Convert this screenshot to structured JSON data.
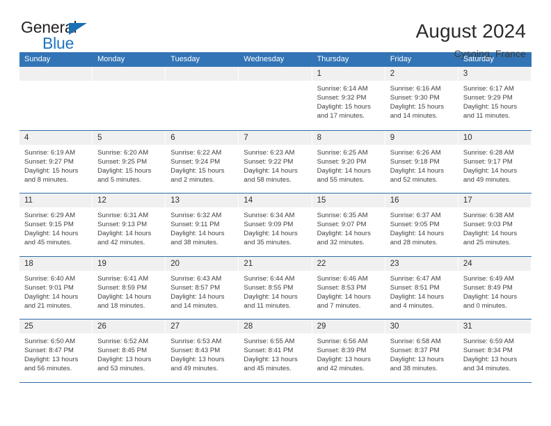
{
  "brand": {
    "name_top": "General",
    "name_bottom": "Blue",
    "triangle_color": "#1a6fb5"
  },
  "header": {
    "title": "August 2024",
    "subtitle": "Cysoing, France"
  },
  "theme": {
    "header_blue": "#3274b5",
    "rule_blue": "#2f6ca8",
    "datebar_gray": "#f0f0f0"
  },
  "calendar": {
    "weekday_headers": [
      "Sunday",
      "Monday",
      "Tuesday",
      "Wednesday",
      "Thursday",
      "Friday",
      "Saturday"
    ],
    "labels": {
      "sunrise": "Sunrise:",
      "sunset": "Sunset:",
      "daylight": "Daylight:"
    },
    "weeks": [
      [
        {
          "day": "",
          "empty": true
        },
        {
          "day": "",
          "empty": true
        },
        {
          "day": "",
          "empty": true
        },
        {
          "day": "",
          "empty": true
        },
        {
          "day": "1",
          "sunrise": "Sunrise: 6:14 AM",
          "sunset": "Sunset: 9:32 PM",
          "daylight1": "Daylight: 15 hours",
          "daylight2": "and 17 minutes."
        },
        {
          "day": "2",
          "sunrise": "Sunrise: 6:16 AM",
          "sunset": "Sunset: 9:30 PM",
          "daylight1": "Daylight: 15 hours",
          "daylight2": "and 14 minutes."
        },
        {
          "day": "3",
          "sunrise": "Sunrise: 6:17 AM",
          "sunset": "Sunset: 9:29 PM",
          "daylight1": "Daylight: 15 hours",
          "daylight2": "and 11 minutes."
        }
      ],
      [
        {
          "day": "4",
          "sunrise": "Sunrise: 6:19 AM",
          "sunset": "Sunset: 9:27 PM",
          "daylight1": "Daylight: 15 hours",
          "daylight2": "and 8 minutes."
        },
        {
          "day": "5",
          "sunrise": "Sunrise: 6:20 AM",
          "sunset": "Sunset: 9:25 PM",
          "daylight1": "Daylight: 15 hours",
          "daylight2": "and 5 minutes."
        },
        {
          "day": "6",
          "sunrise": "Sunrise: 6:22 AM",
          "sunset": "Sunset: 9:24 PM",
          "daylight1": "Daylight: 15 hours",
          "daylight2": "and 2 minutes."
        },
        {
          "day": "7",
          "sunrise": "Sunrise: 6:23 AM",
          "sunset": "Sunset: 9:22 PM",
          "daylight1": "Daylight: 14 hours",
          "daylight2": "and 58 minutes."
        },
        {
          "day": "8",
          "sunrise": "Sunrise: 6:25 AM",
          "sunset": "Sunset: 9:20 PM",
          "daylight1": "Daylight: 14 hours",
          "daylight2": "and 55 minutes."
        },
        {
          "day": "9",
          "sunrise": "Sunrise: 6:26 AM",
          "sunset": "Sunset: 9:18 PM",
          "daylight1": "Daylight: 14 hours",
          "daylight2": "and 52 minutes."
        },
        {
          "day": "10",
          "sunrise": "Sunrise: 6:28 AM",
          "sunset": "Sunset: 9:17 PM",
          "daylight1": "Daylight: 14 hours",
          "daylight2": "and 49 minutes."
        }
      ],
      [
        {
          "day": "11",
          "sunrise": "Sunrise: 6:29 AM",
          "sunset": "Sunset: 9:15 PM",
          "daylight1": "Daylight: 14 hours",
          "daylight2": "and 45 minutes."
        },
        {
          "day": "12",
          "sunrise": "Sunrise: 6:31 AM",
          "sunset": "Sunset: 9:13 PM",
          "daylight1": "Daylight: 14 hours",
          "daylight2": "and 42 minutes."
        },
        {
          "day": "13",
          "sunrise": "Sunrise: 6:32 AM",
          "sunset": "Sunset: 9:11 PM",
          "daylight1": "Daylight: 14 hours",
          "daylight2": "and 38 minutes."
        },
        {
          "day": "14",
          "sunrise": "Sunrise: 6:34 AM",
          "sunset": "Sunset: 9:09 PM",
          "daylight1": "Daylight: 14 hours",
          "daylight2": "and 35 minutes."
        },
        {
          "day": "15",
          "sunrise": "Sunrise: 6:35 AM",
          "sunset": "Sunset: 9:07 PM",
          "daylight1": "Daylight: 14 hours",
          "daylight2": "and 32 minutes."
        },
        {
          "day": "16",
          "sunrise": "Sunrise: 6:37 AM",
          "sunset": "Sunset: 9:05 PM",
          "daylight1": "Daylight: 14 hours",
          "daylight2": "and 28 minutes."
        },
        {
          "day": "17",
          "sunrise": "Sunrise: 6:38 AM",
          "sunset": "Sunset: 9:03 PM",
          "daylight1": "Daylight: 14 hours",
          "daylight2": "and 25 minutes."
        }
      ],
      [
        {
          "day": "18",
          "sunrise": "Sunrise: 6:40 AM",
          "sunset": "Sunset: 9:01 PM",
          "daylight1": "Daylight: 14 hours",
          "daylight2": "and 21 minutes."
        },
        {
          "day": "19",
          "sunrise": "Sunrise: 6:41 AM",
          "sunset": "Sunset: 8:59 PM",
          "daylight1": "Daylight: 14 hours",
          "daylight2": "and 18 minutes."
        },
        {
          "day": "20",
          "sunrise": "Sunrise: 6:43 AM",
          "sunset": "Sunset: 8:57 PM",
          "daylight1": "Daylight: 14 hours",
          "daylight2": "and 14 minutes."
        },
        {
          "day": "21",
          "sunrise": "Sunrise: 6:44 AM",
          "sunset": "Sunset: 8:55 PM",
          "daylight1": "Daylight: 14 hours",
          "daylight2": "and 11 minutes."
        },
        {
          "day": "22",
          "sunrise": "Sunrise: 6:46 AM",
          "sunset": "Sunset: 8:53 PM",
          "daylight1": "Daylight: 14 hours",
          "daylight2": "and 7 minutes."
        },
        {
          "day": "23",
          "sunrise": "Sunrise: 6:47 AM",
          "sunset": "Sunset: 8:51 PM",
          "daylight1": "Daylight: 14 hours",
          "daylight2": "and 4 minutes."
        },
        {
          "day": "24",
          "sunrise": "Sunrise: 6:49 AM",
          "sunset": "Sunset: 8:49 PM",
          "daylight1": "Daylight: 14 hours",
          "daylight2": "and 0 minutes."
        }
      ],
      [
        {
          "day": "25",
          "sunrise": "Sunrise: 6:50 AM",
          "sunset": "Sunset: 8:47 PM",
          "daylight1": "Daylight: 13 hours",
          "daylight2": "and 56 minutes."
        },
        {
          "day": "26",
          "sunrise": "Sunrise: 6:52 AM",
          "sunset": "Sunset: 8:45 PM",
          "daylight1": "Daylight: 13 hours",
          "daylight2": "and 53 minutes."
        },
        {
          "day": "27",
          "sunrise": "Sunrise: 6:53 AM",
          "sunset": "Sunset: 8:43 PM",
          "daylight1": "Daylight: 13 hours",
          "daylight2": "and 49 minutes."
        },
        {
          "day": "28",
          "sunrise": "Sunrise: 6:55 AM",
          "sunset": "Sunset: 8:41 PM",
          "daylight1": "Daylight: 13 hours",
          "daylight2": "and 45 minutes."
        },
        {
          "day": "29",
          "sunrise": "Sunrise: 6:56 AM",
          "sunset": "Sunset: 8:39 PM",
          "daylight1": "Daylight: 13 hours",
          "daylight2": "and 42 minutes."
        },
        {
          "day": "30",
          "sunrise": "Sunrise: 6:58 AM",
          "sunset": "Sunset: 8:37 PM",
          "daylight1": "Daylight: 13 hours",
          "daylight2": "and 38 minutes."
        },
        {
          "day": "31",
          "sunrise": "Sunrise: 6:59 AM",
          "sunset": "Sunset: 8:34 PM",
          "daylight1": "Daylight: 13 hours",
          "daylight2": "and 34 minutes."
        }
      ]
    ]
  }
}
